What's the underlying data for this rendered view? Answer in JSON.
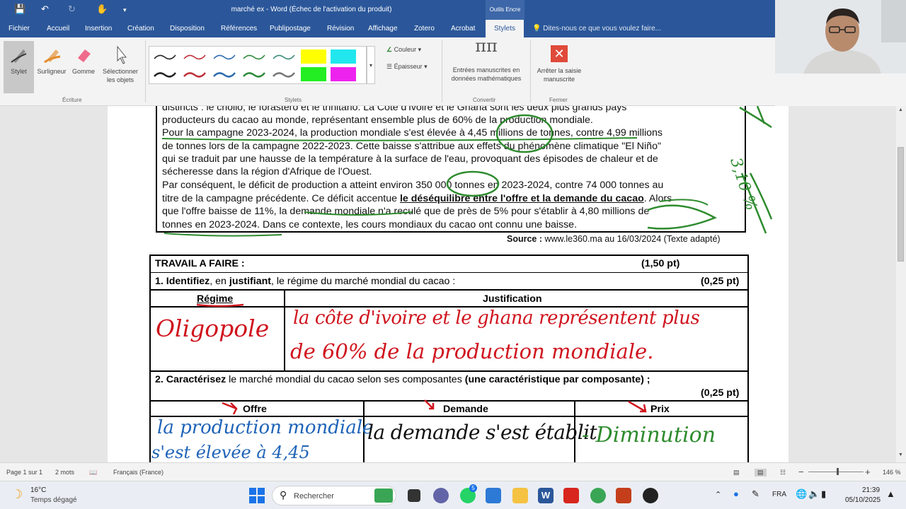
{
  "window": {
    "title": "marché ex - Word (Échec de l'activation du produit)",
    "contextual_tab_group": "Outils Encre"
  },
  "tabs": [
    "Fichier",
    "Accueil",
    "Insertion",
    "Création",
    "Disposition",
    "Références",
    "Publipostage",
    "Révision",
    "Affichage",
    "Zotero",
    "Acrobat",
    "Stylets"
  ],
  "active_tab": "Stylets",
  "tell_me": "Dites-nous ce que vous voulez faire...",
  "ribbon": {
    "stylet": "Stylet",
    "surligneur": "Surligneur",
    "gomme": "Gomme",
    "select_line1": "Sélectionner",
    "select_line2": "les objets",
    "group_ecriture": "Écriture",
    "group_stylets": "Stylets",
    "couleur": "Couleur",
    "epaisseur": "Épaisseur",
    "math_line1": "Entrées manuscrites en",
    "math_line2": "données mathématiques",
    "group_convertir": "Convertir",
    "stop_line1": "Arrêter la saisie",
    "stop_line2": "manuscrite",
    "group_fermer": "Fermer"
  },
  "document": {
    "lines": [
      "distincts : le criollo, le forastero et le trinitario. La Côte d'Ivoire et le Ghana sont les deux plus grands pays",
      "producteurs du cacao au monde, représentant ensemble plus de 60% de la production mondiale.",
      "Pour la campagne 2023-2024, la production mondiale s'est élevée à 4,45 millions de tonnes, contre 4,99 millions",
      "de tonnes lors de la campagne 2022-2023. Cette baisse s'attribue aux effets du phénomène climatique \"El Niño\"",
      "qui se traduit par une hausse de la température à la surface de l'eau, provoquant des épisodes de chaleur et de",
      "sécheresse dans la région d'Afrique de l'Ouest.",
      "Par conséquent, le déficit de production a atteint environ 350 000 tonnes en 2023-2024, contre 74 000 tonnes au"
    ],
    "line8_a": "titre de la campagne précédente. Ce déficit accentue ",
    "line8_b": "le déséquilibre entre l'offre et la demande du cacao",
    "line8_c": ". Alors",
    "line9": "que l'offre baisse de 11%, la demande mondiale n'a reculé que de près de 5% pour s'établir à 4,80 millions de",
    "line10": "tonnes en 2023-2024. Dans ce contexte, les cours mondiaux du cacao ont connu une baisse.",
    "source_label": "Source :",
    "source_value": "www.le360.ma au 16/03/2024 (Texte adapté)"
  },
  "task": {
    "header": "TRAVAIL A FAIRE :",
    "header_pts": "(1,50 pt)",
    "q1_num": "1.",
    "q1_verb1": "Identifiez",
    "q1_mid": ", en ",
    "q1_verb2": "justifiant",
    "q1_rest": ", le régime du marché mondial du cacao :",
    "q1_pts": "(0,25 pt)",
    "col_regime": "Régime",
    "col_justification": "Justification",
    "hw_regime": "Oligopole",
    "hw_justif_1": "la côte d'ivoire et le ghana représentent plus",
    "hw_justif_2": "de 60% de la production mondiale.",
    "q2_num": "2.",
    "q2_verb": "Caractérisez",
    "q2_rest": " le marché mondial du cacao selon ses composantes ",
    "q2_paren": "(une caractéristique par composante) ;",
    "q2_pts": "(0,25 pt)",
    "col_offre": "Offre",
    "col_demande": "Demande",
    "col_prix": "Prix",
    "hw_offre_1": "la production mondiale",
    "hw_offre_2": "s'est élevée à 4,45",
    "hw_demande_1": "la demande s'est établit",
    "hw_prix_1": "- Diminution",
    "hw_margin": "3,10 %"
  },
  "status": {
    "page": "Page 1 sur 1",
    "words": "2 mots",
    "lang": "Français (France)",
    "zoom": "146 %"
  },
  "taskbar": {
    "weather_temp": "16°C",
    "weather_desc": "Temps dégagé",
    "search": "Rechercher",
    "lang": "FRA",
    "time": "21:39",
    "date": "05/10/2025",
    "whatsapp_badge": "5"
  },
  "colors": {
    "word_blue": "#2b579a",
    "ink_red": "#d0141e",
    "ink_green": "#2e8b2e",
    "ink_blue": "#1e63b8"
  }
}
